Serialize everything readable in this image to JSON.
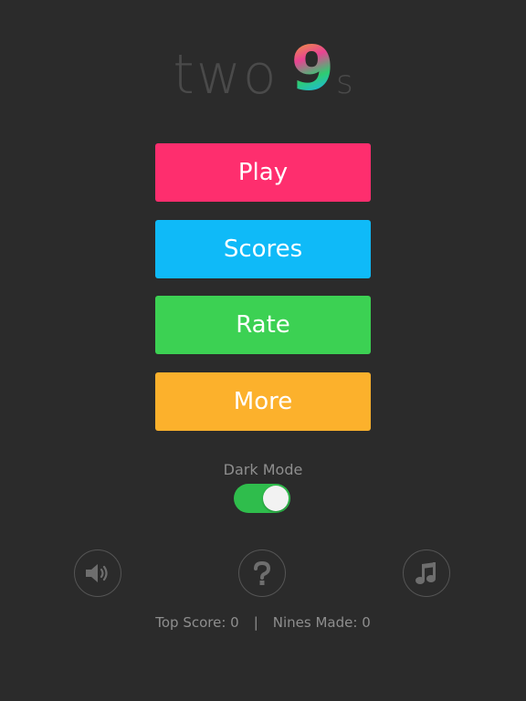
{
  "logo": {
    "word": "two",
    "nine": "9",
    "suffix": "s"
  },
  "menu": {
    "play_label": "Play",
    "scores_label": "Scores",
    "rate_label": "Rate",
    "more_label": "More"
  },
  "colors": {
    "background": "#2b2b2b",
    "play": "#fe2e6e",
    "scores": "#0fbaf8",
    "rate": "#3cd153",
    "more": "#fcb12c",
    "toggle_on": "#2fbd4c"
  },
  "dark_mode": {
    "label": "Dark Mode",
    "enabled": true
  },
  "icons": {
    "sound": "speaker-icon",
    "help": "question-icon",
    "music": "music-note-icon"
  },
  "footer": {
    "top_score": "Top Score: 0",
    "separator": "|",
    "nines_made": "Nines Made: 0"
  }
}
